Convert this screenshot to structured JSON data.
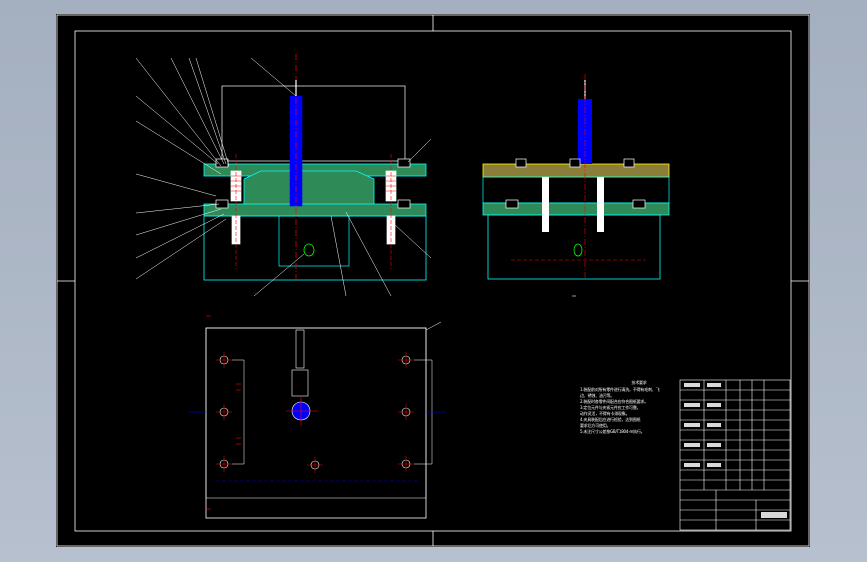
{
  "technical_requirements": {
    "title": "技术要求",
    "lines": [
      "1.装配前对所有零件进行清洗，不得有毛刺、飞",
      "边、锈蚀、油污等。",
      "2.装配时各零件间配合应符合图纸要求。",
      "3.定位元件与夹紧元件应工作可靠，",
      "动作灵活，不得有卡滞现象。",
      "",
      "4.夹具装配后应进行检验，达到图纸",
      "要求后方可使用。",
      "5.未注尺寸公差按GB/T1804-m执行。"
    ]
  },
  "colors": {
    "sheet": "#000000",
    "frame": "#ffffff",
    "outline": "#00ffff",
    "plate": "#008b8b",
    "section_fill": "#2e8b57",
    "yellow": "#ffff00",
    "red": "#ff0000",
    "blue": "#0000ff",
    "green": "#00ff00",
    "orange": "#ffa500",
    "magenta": "#ff00ff",
    "viewport_bg": "#a9b4c4"
  }
}
